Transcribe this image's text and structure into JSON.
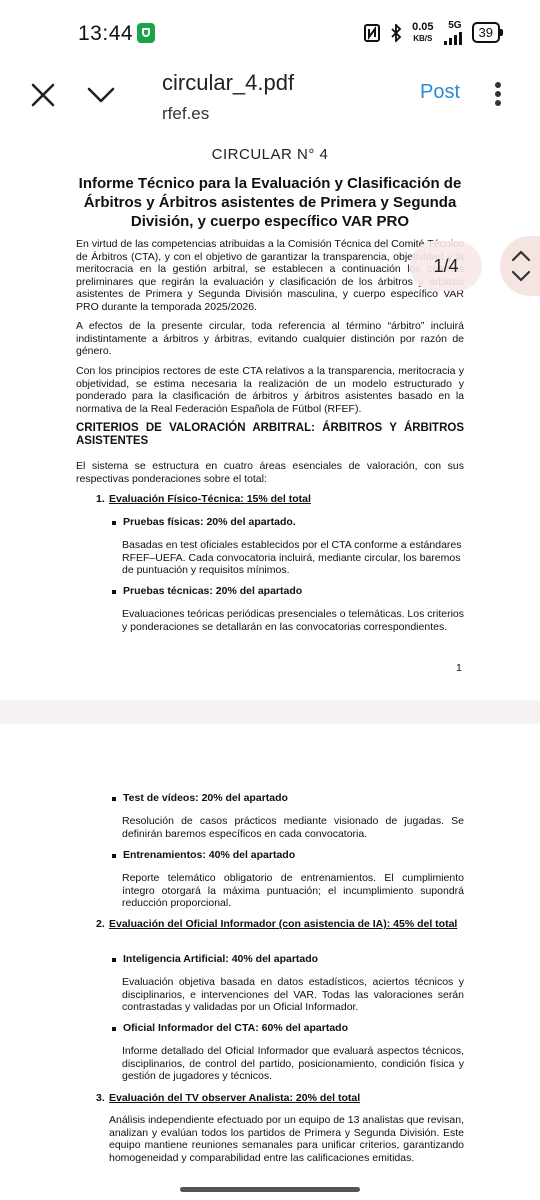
{
  "status_bar": {
    "time": "13:44",
    "net_speed": "0.05",
    "net_unit": "KB/S",
    "network": "5G",
    "battery": "39",
    "icons": [
      "shield-icon",
      "nfc-icon",
      "bluetooth-icon",
      "signal-icon",
      "battery-icon"
    ]
  },
  "header": {
    "title": "circular_4.pdf",
    "subtitle": "rfef.es",
    "post_label": "Post",
    "accent": "#2a8bd6"
  },
  "page_indicator": "1/4",
  "page1": {
    "circular": "CIRCULAR N° 4",
    "title": "Informe Técnico para la Evaluación y Clasificación de Árbitros y Árbitros asistentes de Primera y Segunda División, y cuerpo específico VAR PRO",
    "para1": "En virtud de las competencias atribuidas a la Comisión Técnica del Comité Técnico de Árbitros (CTA), y con el objetivo de garantizar la transparencia, objetividad y la meritocracia en la gestión arbitral, se establecen a continuación los criterios preliminares que regirán la evaluación y clasificación de los árbitros y árbitros asistentes de Primera y Segunda División masculina, y cuerpo específico VAR PRO durante la temporada 2025/2026.",
    "para2": "A efectos de la presente circular, toda referencia al término “árbitro” incluirá indistintamente a árbitros y árbitras, evitando cualquier distinción por razón de género.",
    "para3": "Con los principios rectores de este CTA relativos a la transparencia, meritocracia y objetividad, se estima necesaria la realización de un modelo estructurado y ponderado para la clasificación de árbitros y árbitros asistentes basado en la normativa de la Real Federación Española de Fútbol (RFEF).",
    "heading": "CRITERIOS DE VALORACIÓN ARBITRAL: ÁRBITROS Y ÁRBITROS ASISTENTES",
    "para4": "El sistema se estructura en cuatro áreas esenciales de valoración, con sus respectivas ponderaciones sobre el total:",
    "item1_num": "1.",
    "item1": "Evaluación Físico-Técnica: 15% del total",
    "b1": "Pruebas físicas: 20% del apartado.",
    "b1_text": "Basadas en test oficiales establecidos por el CTA conforme a estándares RFEF–UEFA. Cada convocatoria incluirá, mediante circular, los baremos de puntuación y requisitos mínimos.",
    "b2": "Pruebas técnicas: 20% del apartado",
    "b2_text": "Evaluaciones teóricas periódicas presenciales o telemáticas. Los criterios y ponderaciones se detallarán en las convocatorias correspondientes.",
    "page_number": "1"
  },
  "page2": {
    "b3": "Test de vídeos: 20% del apartado",
    "b3_text": "Resolución de casos prácticos mediante visionado de jugadas. Se definirán baremos específicos en cada convocatoria.",
    "b4": "Entrenamientos: 40% del apartado",
    "b4_text": "Reporte telemático obligatorio de entrenamientos. El cumplimiento íntegro otorgará la máxima puntuación; el incumplimiento supondrá reducción proporcional.",
    "item2_num": "2.",
    "item2": "Evaluación del Oficial Informador (con asistencia de IA): 45% del total",
    "b5": "Inteligencia Artificial: 40% del apartado",
    "b5_text": "Evaluación objetiva basada en datos estadísticos, aciertos técnicos y disciplinarios, e intervenciones del VAR. Todas las valoraciones serán contrastadas y validadas por un Oficial Informador.",
    "b6": "Oficial Informador del CTA: 60% del apartado",
    "b6_text": "Informe detallado del Oficial Informador que evaluará aspectos técnicos, disciplinarios, de control del partido, posicionamiento, condición física y gestión de jugadores y técnicos.",
    "item3_num": "3.",
    "item3": "Evaluación del TV observer Analista: 20% del total",
    "item3_text": "Análisis independiente efectuado por un equipo de 13 analistas que revisan, analizan y evalúan todos los partidos de Primera y Segunda División. Este equipo mantiene reuniones semanales para unificar criterios, garantizando homogeneidad y comparabilidad entre las calificaciones emitidas."
  }
}
